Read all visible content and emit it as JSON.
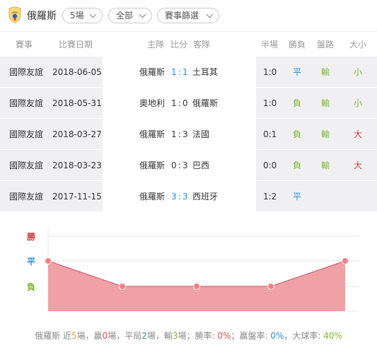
{
  "header": {
    "team_name": "俄羅斯",
    "filter_count": "5場",
    "filter_scope": "全部",
    "filter_league": "賽事篩選"
  },
  "columns": {
    "league": "賽事",
    "date": "比賽日期",
    "home": "主隊",
    "score": "比分",
    "away": "客隊",
    "half": "半場",
    "result": "勝負",
    "handicap": "盤路",
    "ou": "大小"
  },
  "matches": [
    {
      "league": "國際友誼",
      "date": "2018-06-05",
      "home": "俄羅斯",
      "score_home": "1",
      "score_sep": ":",
      "score_away": "1",
      "away": "土耳其",
      "half": "1:0",
      "result": "平",
      "handicap": "輸",
      "ou": "小"
    },
    {
      "league": "國際友誼",
      "date": "2018-05-31",
      "home": "奧地利",
      "score_home": "1",
      "score_sep": ":",
      "score_away": "0",
      "away": "俄羅斯",
      "half": "1:0",
      "result": "負",
      "handicap": "輸",
      "ou": "小"
    },
    {
      "league": "國際友誼",
      "date": "2018-03-27",
      "home": "俄羅斯",
      "score_home": "1",
      "score_sep": ":",
      "score_away": "3",
      "away": "法國",
      "half": "0:1",
      "result": "負",
      "handicap": "輸",
      "ou": "大"
    },
    {
      "league": "國際友誼",
      "date": "2018-03-23",
      "home": "俄羅斯",
      "score_home": "0",
      "score_sep": ":",
      "score_away": "3",
      "away": "巴西",
      "half": "0:0",
      "result": "負",
      "handicap": "輸",
      "ou": "大"
    },
    {
      "league": "國際友誼",
      "date": "2017-11-15",
      "home": "俄羅斯",
      "score_home": "3",
      "score_sep": ":",
      "score_away": "3",
      "away": "西班牙",
      "half": "1:2",
      "result": "平",
      "handicap": "",
      "ou": ""
    }
  ],
  "chart_data": {
    "type": "area",
    "y_categories": [
      "勝",
      "平",
      "負"
    ],
    "values": [
      "平",
      "負",
      "負",
      "負",
      "平"
    ],
    "order": "oldest-to-newest",
    "colors": {
      "fill": "#f1a0a6",
      "line": "#c85060",
      "point": "#f08080"
    }
  },
  "summary": {
    "team": "俄羅斯",
    "t1": " 近",
    "recent": "5",
    "t2": "場，贏",
    "wins": "0",
    "t3": "場，平局",
    "draws": "2",
    "t4": "場，輸",
    "losses": "3",
    "t5": "場；勝率: ",
    "win_rate": "0%",
    "t6": "；贏盤率: ",
    "handicap_rate": "0%",
    "t7": "，大球率: ",
    "over_rate": "40%"
  },
  "colors": {
    "win": "#c83a3a",
    "draw": "#2a8ed4",
    "lose": "#7cb82f",
    "row_bg": "#f0f0f3"
  }
}
